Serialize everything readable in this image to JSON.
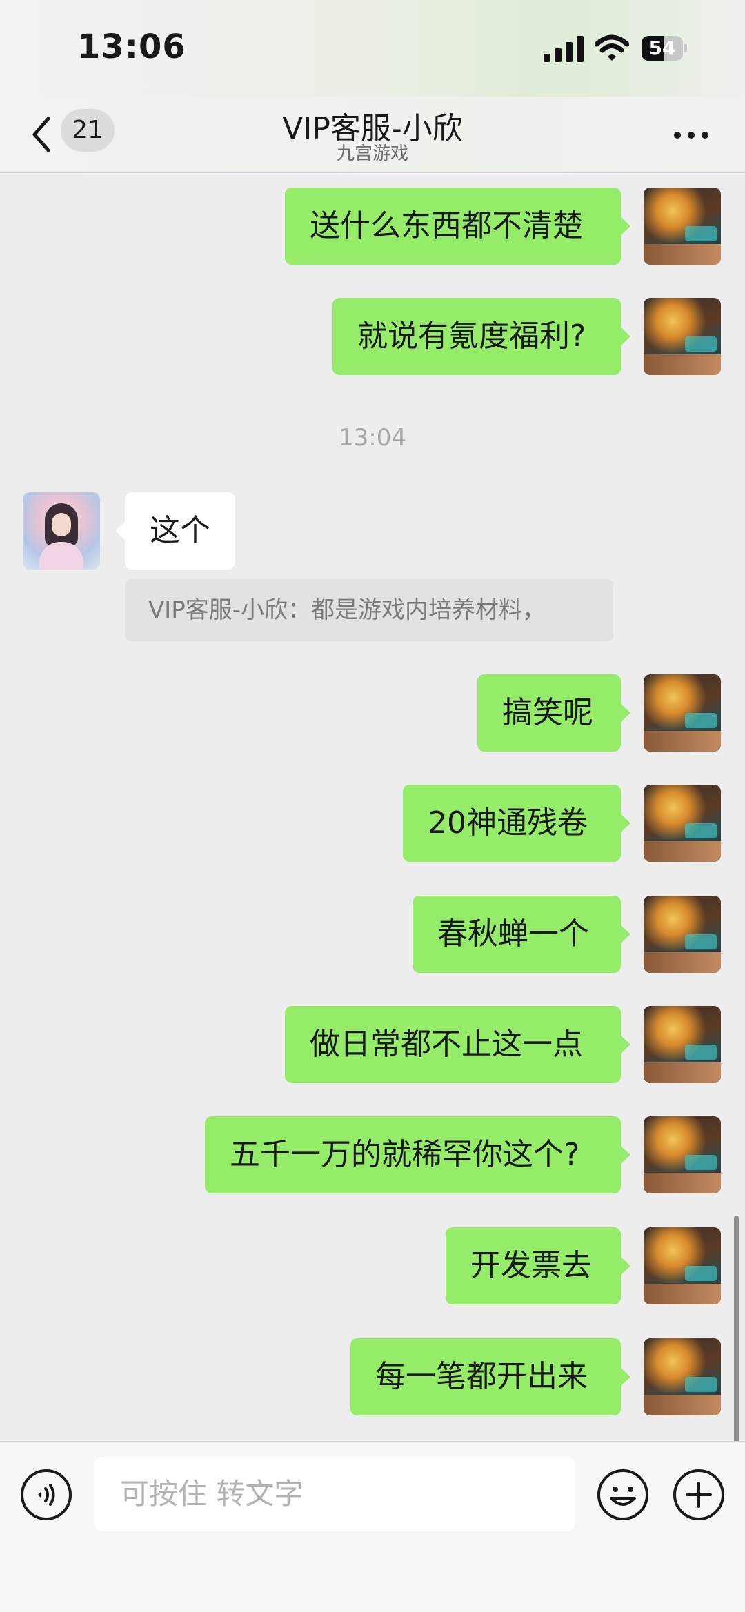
{
  "status_bar": {
    "time": "13:06",
    "battery_level": "54",
    "battery_fraction": 0.54
  },
  "header": {
    "unread_count": "21",
    "title": "VIP客服-小欣",
    "subtitle": "九宫游戏"
  },
  "messages": [
    {
      "type": "mine",
      "text": "送什么东西都不清楚"
    },
    {
      "type": "mine",
      "text": "就说有氪度福利?"
    },
    {
      "type": "timestamp",
      "text": "13:04"
    },
    {
      "type": "theirs",
      "text": "这个"
    },
    {
      "type": "quote",
      "text": "VIP客服-小欣：都是游戏内培养材料，"
    },
    {
      "type": "mine",
      "text": "搞笑呢"
    },
    {
      "type": "mine",
      "text": "20神通残卷"
    },
    {
      "type": "mine",
      "text": "春秋蝉一个"
    },
    {
      "type": "mine",
      "text": "做日常都不止这一点"
    },
    {
      "type": "mine",
      "text": "五千一万的就稀罕你这个?"
    },
    {
      "type": "mine",
      "text": "开发票去"
    },
    {
      "type": "mine",
      "text": "每一笔都开出来"
    }
  ],
  "input": {
    "placeholder": "可按住 转文字"
  },
  "icons": {
    "back": "chevron-left-icon",
    "more": "more-dots-icon",
    "voice": "voice-icon",
    "emoji": "emoji-icon",
    "plus": "plus-icon"
  },
  "colors": {
    "my_bubble": "#95ec69",
    "their_bubble": "#ffffff",
    "background": "#ededed"
  }
}
